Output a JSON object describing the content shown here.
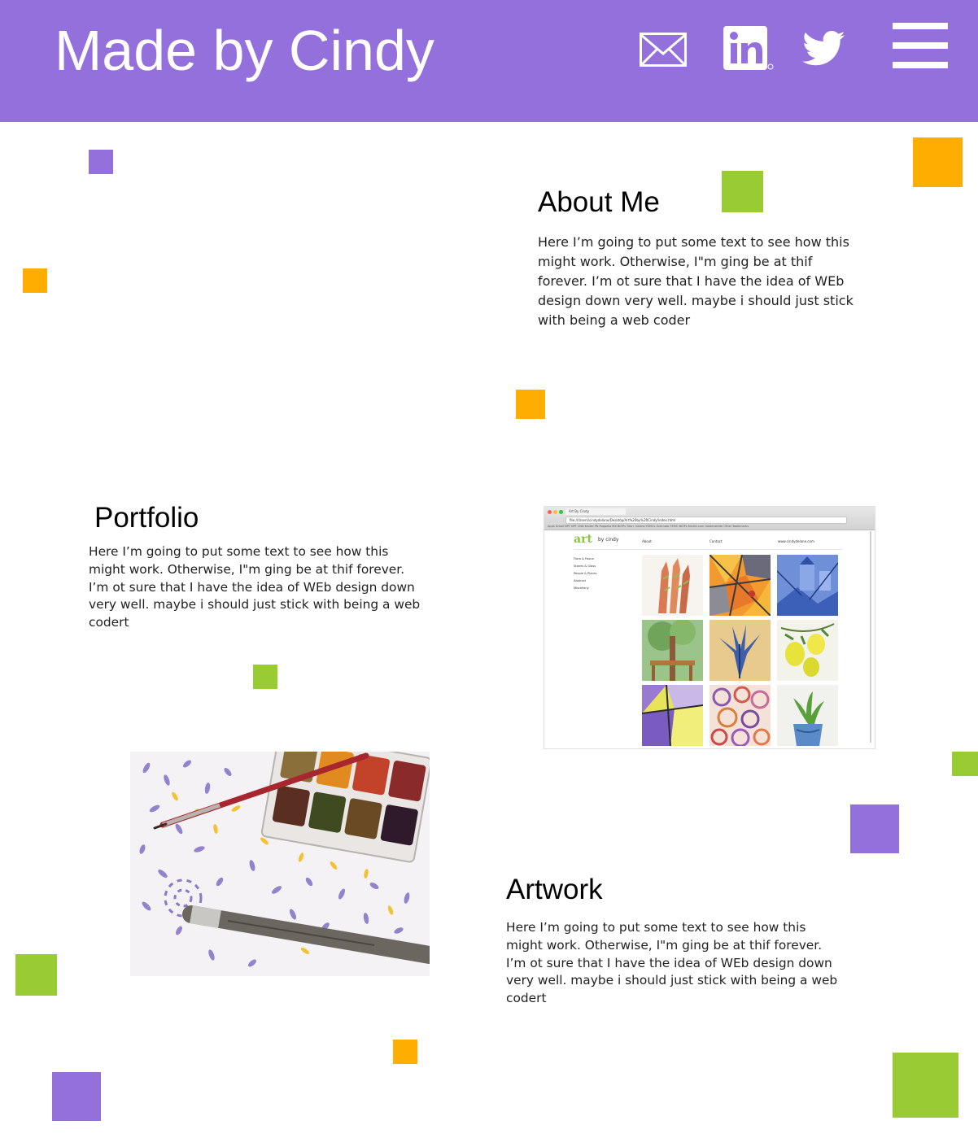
{
  "header": {
    "site_title": "Made by Cindy",
    "background_color": "#9370DB",
    "icons": [
      "mail-icon",
      "linkedin-icon",
      "twitter-icon",
      "hamburger-menu-icon"
    ]
  },
  "about": {
    "title": "About Me",
    "text": "Here I’m going to put some text to see how this might work. Otherwise, I\"m ging be at thif forever. I’m ot sure that I have the idea of WEb design down very well. maybe i should just stick with being a web coder"
  },
  "portfolio": {
    "title": "Portfolio",
    "text": "Here I’m going to put some text to see how this might work. Otherwise, I\"m ging be at thif forever. I’m ot sure that I have the idea of WEb design down very well. maybe i should just stick with being a web codert",
    "screenshot": {
      "tab_title": "Art By Cindy",
      "url": "file:///Users/cindydelane/Desktop/Art%20by%20Cindy/index.html",
      "bookmarks": "Apps  Gmail  NPF  NPT  CNN  Kindle  PN  Poppelia  MX  BIOPs  Tuts+  Karma  FEMOL  Evernote  FEMO  BIOPs  Kindle.com  Goldenwhite  Other Bookmarks",
      "logo_main": "art",
      "logo_sub": "by cindy",
      "nav": [
        "About",
        "Contact",
        "www.cindydelane.com"
      ],
      "sidebar": [
        "Flora & Fauna",
        "Stones & Glass",
        "People & Places",
        "Abstract",
        "Miscellany"
      ]
    }
  },
  "artwork": {
    "title": "Artwork",
    "text": "Here I’m going to put some text to see how this might work. Otherwise, I\"m ging be at thif forever. I’m ot sure that I have the idea of WEb design down very well. maybe i should just stick with being a web codert"
  },
  "colors": {
    "purple": "#9370DB",
    "orange": "#FFAD00",
    "green": "#99CC33"
  }
}
